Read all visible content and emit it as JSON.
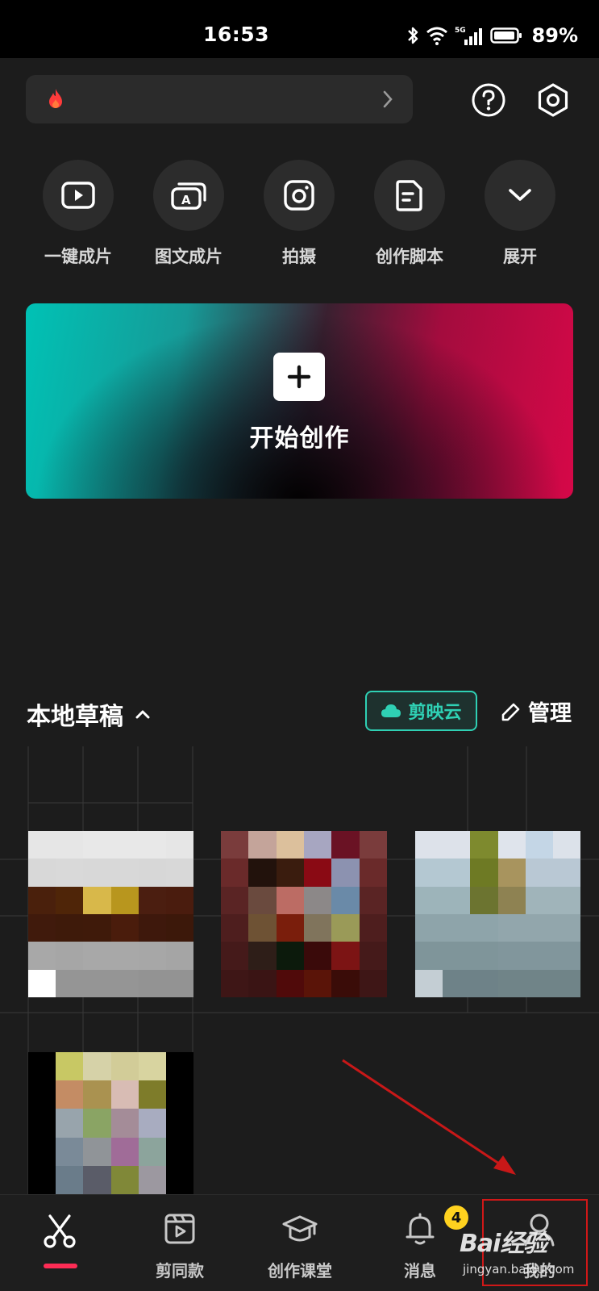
{
  "status_bar": {
    "time": "16:53",
    "network": "5G",
    "battery": "89%"
  },
  "top_bar": {
    "search_placeholder": "",
    "icons": [
      "flame-icon",
      "chevron-right-icon",
      "help-icon",
      "settings-icon"
    ]
  },
  "quick_actions": [
    {
      "label": "一键成片",
      "icon": "play-icon"
    },
    {
      "label": "图文成片",
      "icon": "text-image-icon"
    },
    {
      "label": "拍摄",
      "icon": "camera-icon"
    },
    {
      "label": "创作脚本",
      "icon": "script-icon"
    },
    {
      "label": "展开",
      "icon": "chevron-down-icon"
    }
  ],
  "create_banner": {
    "label": "开始创作"
  },
  "drafts": {
    "title": "本地草稿",
    "cloud_label": "剪映云",
    "manage_label": "管理"
  },
  "bottom_nav": {
    "items": [
      {
        "label": "",
        "icon": "scissors-icon",
        "active": true
      },
      {
        "label": "剪同款",
        "icon": "template-icon"
      },
      {
        "label": "创作课堂",
        "icon": "graduation-cap-icon"
      },
      {
        "label": "消息",
        "icon": "bell-icon"
      },
      {
        "label": "我的",
        "icon": "person-icon"
      }
    ],
    "message_badge": "4"
  },
  "watermark": {
    "brand": "Bai经验",
    "url": "jingyan.baidu.com"
  },
  "colors": {
    "background": "#1c1c1c",
    "accent_red": "#fe2c55",
    "cloud_teal": "#2fd0b4",
    "badge_yellow": "#ffd21f",
    "annotation_red": "#d01818"
  }
}
